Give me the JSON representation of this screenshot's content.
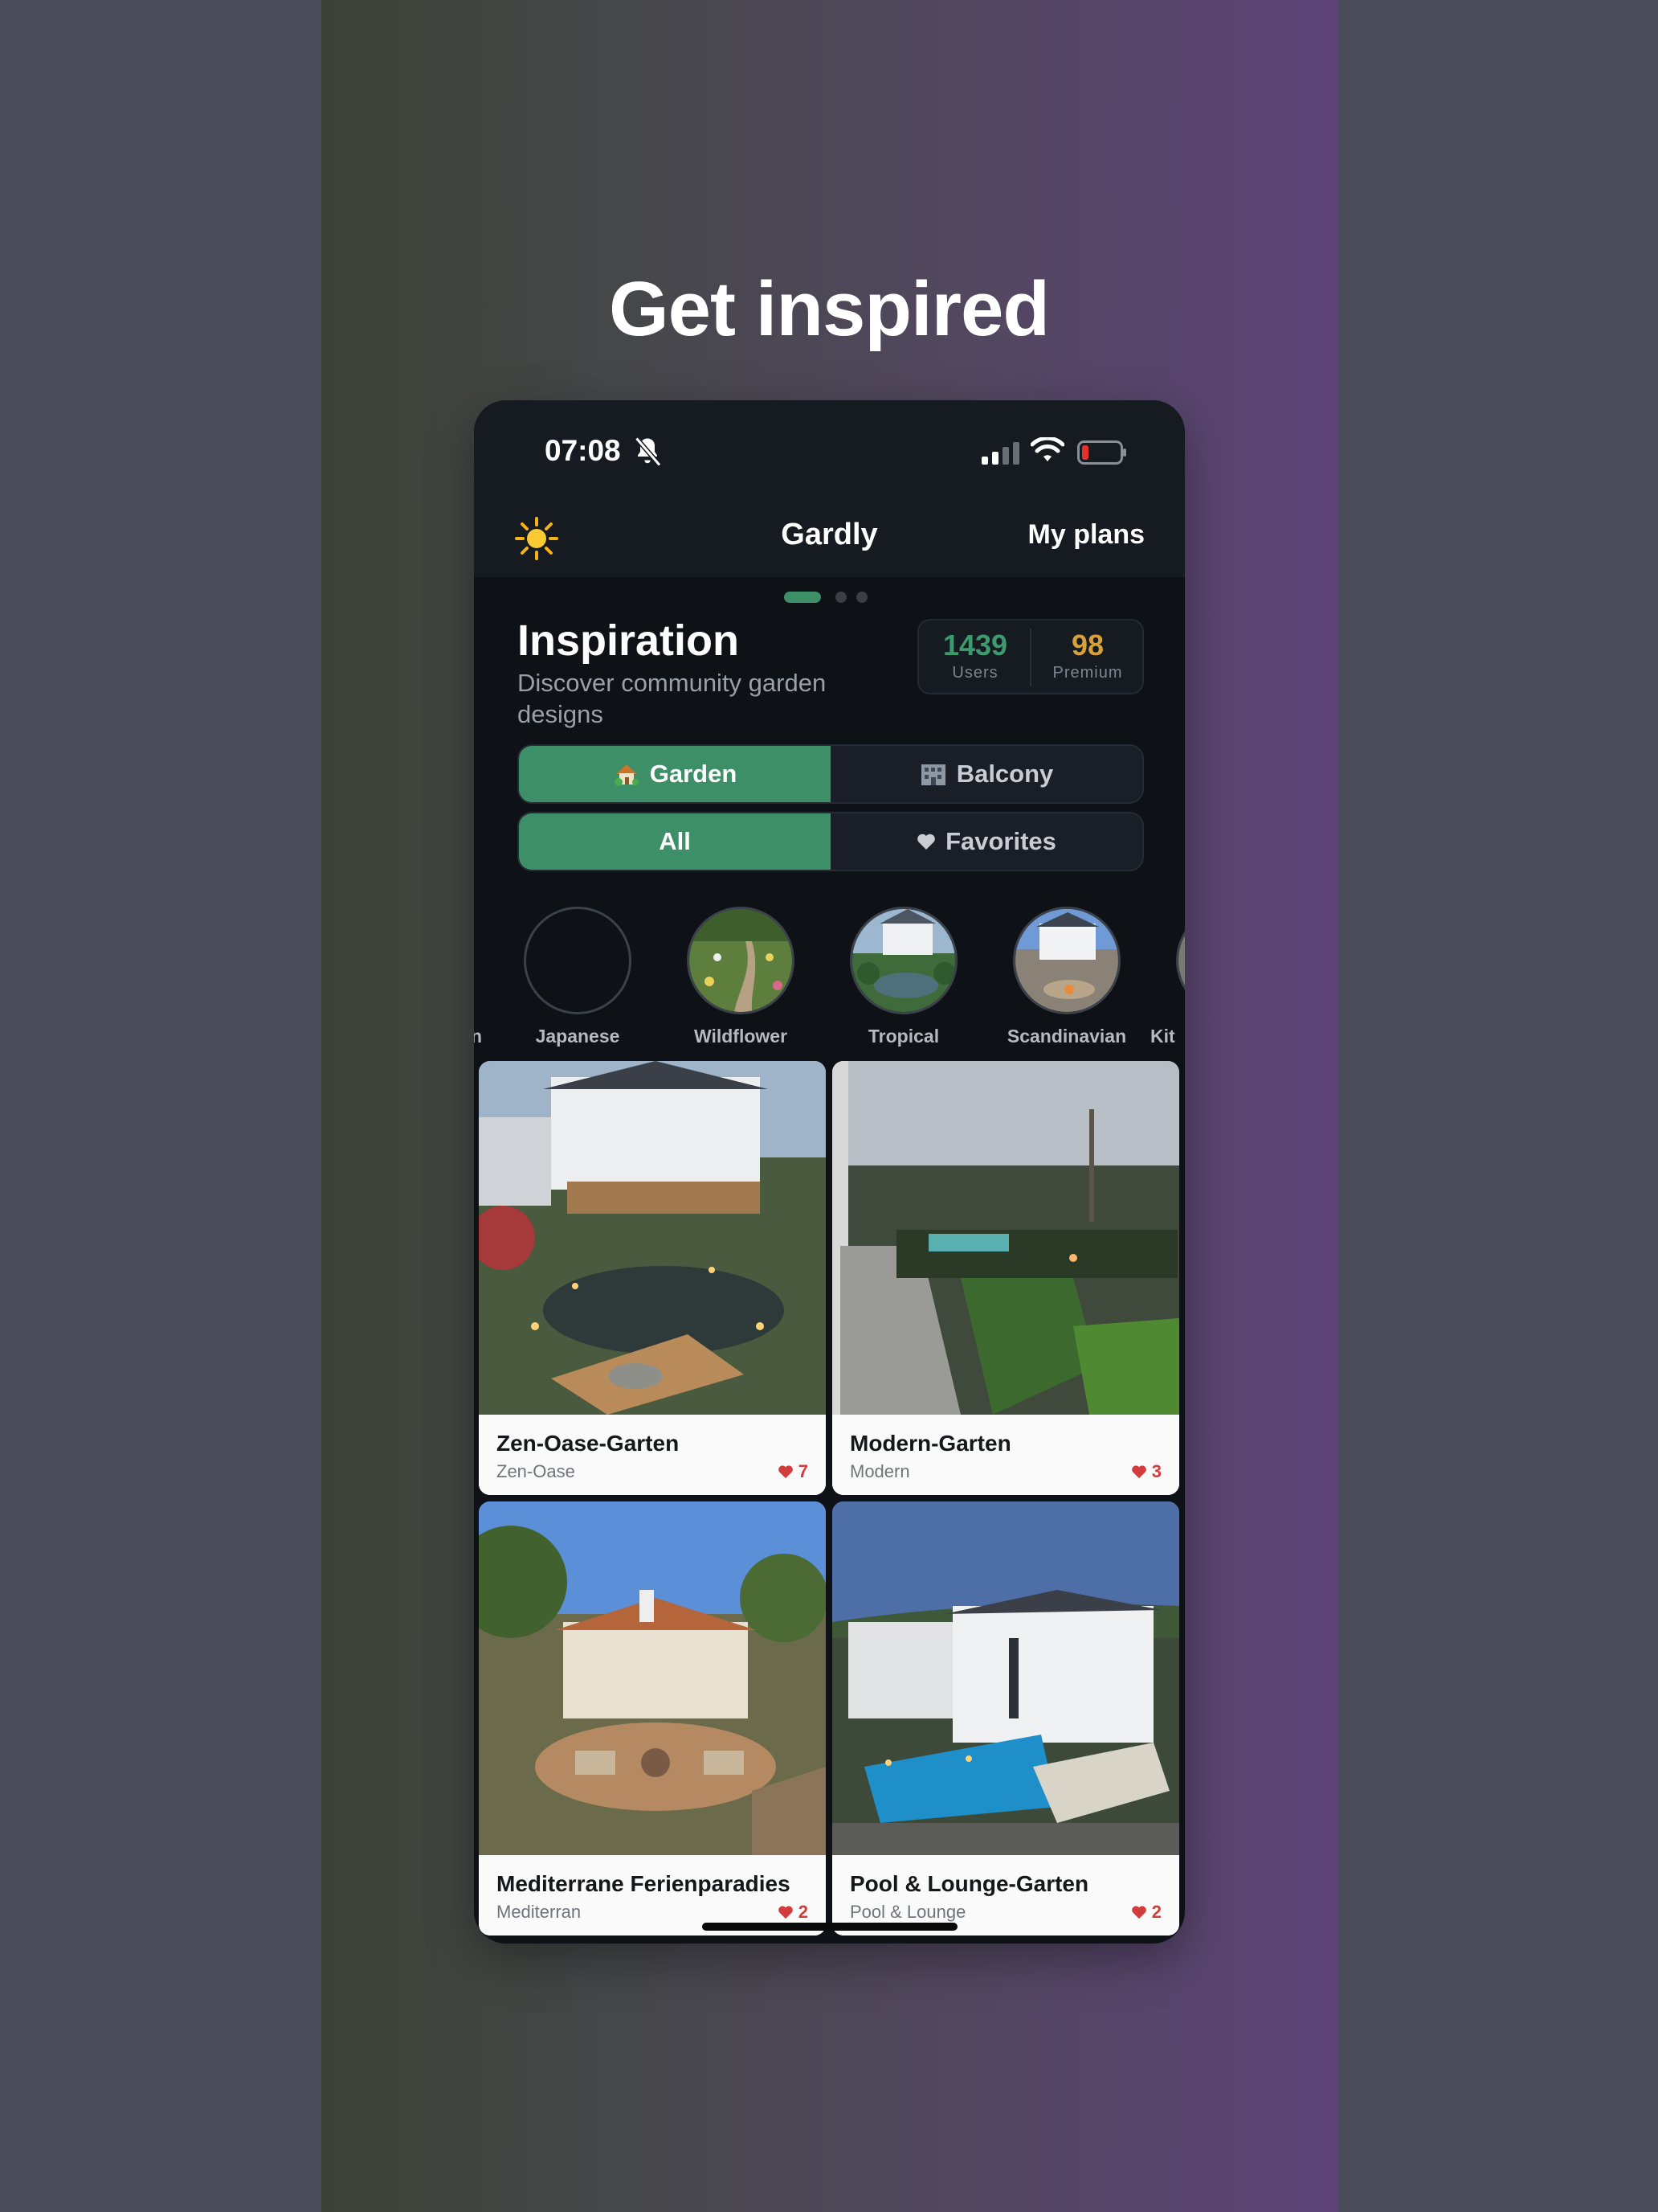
{
  "headline": "Get inspired",
  "status_bar": {
    "time": "07:08"
  },
  "nav": {
    "title": "Gardly",
    "my_plans": "My plans"
  },
  "inspiration": {
    "title": "Inspiration",
    "subtitle": "Discover community garden designs",
    "stats": [
      {
        "value": "1439",
        "label": "Users",
        "color": "#3d9a6e"
      },
      {
        "value": "98",
        "label": "Premium",
        "color": "#d9a03a"
      }
    ]
  },
  "toggle_space": {
    "garden": "Garden",
    "balcony": "Balcony",
    "selected": "Garden"
  },
  "toggle_filter": {
    "all": "All",
    "favorites": "Favorites",
    "selected": "All"
  },
  "styles": [
    {
      "label": "n"
    },
    {
      "label": "Japanese"
    },
    {
      "label": "Wildflower"
    },
    {
      "label": "Tropical"
    },
    {
      "label": "Scandinavian"
    },
    {
      "label": "Kit"
    }
  ],
  "cards": [
    {
      "title": "Zen-Oase-Garten",
      "subtitle": "Zen-Oase",
      "likes": "7"
    },
    {
      "title": "Modern-Garten",
      "subtitle": "Modern",
      "likes": "3"
    },
    {
      "title": "Mediterrane Ferienparadies",
      "subtitle": "Mediterran",
      "likes": "2"
    },
    {
      "title": "Pool & Lounge-Garten",
      "subtitle": "Pool & Lounge",
      "likes": "2"
    }
  ],
  "colors": {
    "accent": "#3d8f68",
    "heart": "#d23c3c",
    "background": "#0e1116"
  }
}
